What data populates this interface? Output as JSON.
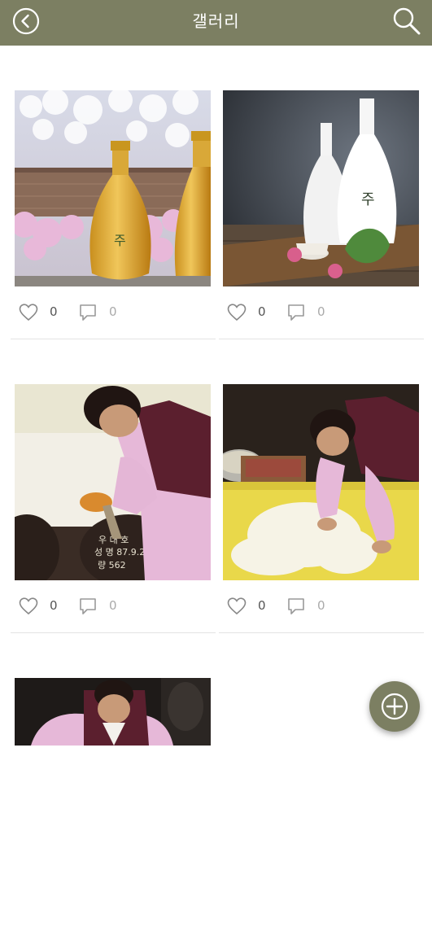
{
  "colors": {
    "bar": "#7c7f62",
    "fab": "#7c7f62"
  },
  "header": {
    "title": "갤러리",
    "back_icon": "chevron-left-circle-icon",
    "search_icon": "search-icon"
  },
  "gallery": [
    {
      "likes": "0",
      "comments": "0"
    },
    {
      "likes": "0",
      "comments": "0"
    },
    {
      "likes": "0",
      "comments": "0"
    },
    {
      "likes": "0",
      "comments": "0"
    },
    {
      "likes": "",
      "comments": ""
    }
  ],
  "fab": {
    "icon": "plus-circle-icon"
  }
}
